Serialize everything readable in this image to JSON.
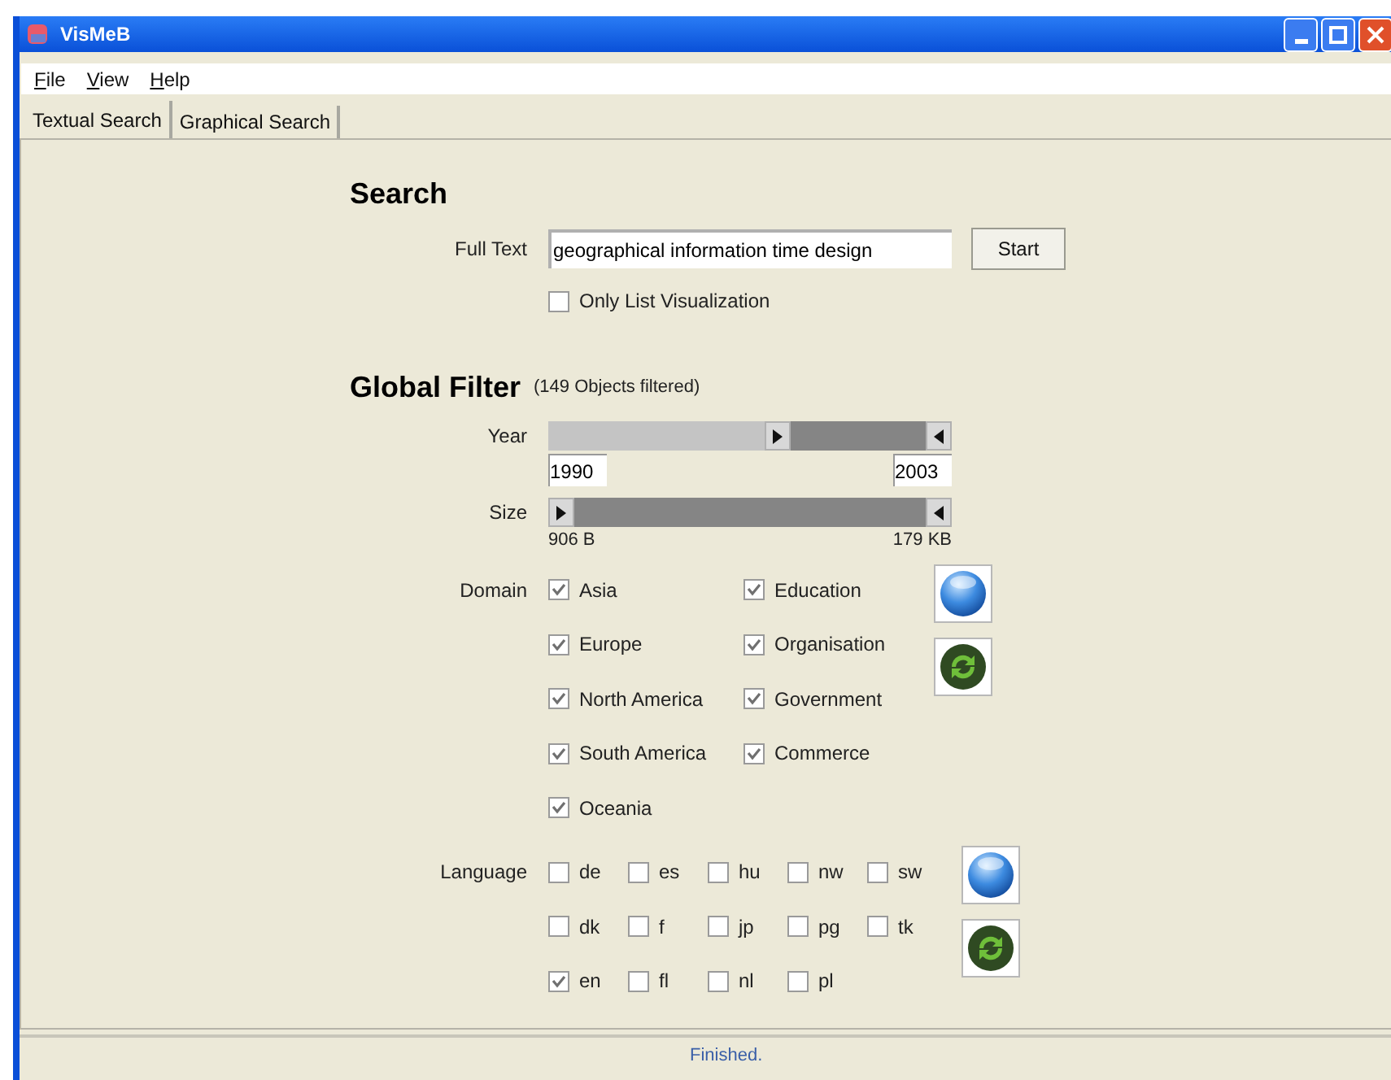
{
  "window": {
    "title": "VisMeB"
  },
  "menu": [
    "File",
    "View",
    "Help"
  ],
  "tabs": [
    {
      "label": "Textual Search",
      "selected": true
    },
    {
      "label": "Graphical Search",
      "selected": false
    }
  ],
  "search": {
    "heading": "Search",
    "full_text": {
      "label": "Full Text",
      "value": "geographical information time design"
    },
    "start_button": "Start",
    "only_list": {
      "label": "Only List Visualization",
      "checked": false
    }
  },
  "global_filter": {
    "heading": "Global Filter",
    "note": "(149 Objects filtered)",
    "year": {
      "label": "Year",
      "level": 0.57,
      "from": "1990",
      "to": "2003"
    },
    "size": {
      "label": "Size",
      "level": 0,
      "from": "906 B",
      "to": "179 KB"
    },
    "domain": {
      "label": "Domain",
      "options": [
        {
          "label": "Asia",
          "checked": true
        },
        {
          "label": "Education",
          "checked": true
        },
        {
          "label": "Europe",
          "checked": true
        },
        {
          "label": "Organisation",
          "checked": true
        },
        {
          "label": "North America",
          "checked": true
        },
        {
          "label": "Government",
          "checked": true
        },
        {
          "label": "South America",
          "checked": true
        },
        {
          "label": "Commerce",
          "checked": true
        },
        {
          "label": "Oceania",
          "checked": true
        }
      ]
    },
    "language": {
      "label": "Language",
      "options": [
        {
          "label": "de",
          "checked": false
        },
        {
          "label": "es",
          "checked": false
        },
        {
          "label": "hu",
          "checked": false
        },
        {
          "label": "nw",
          "checked": false
        },
        {
          "label": "sw",
          "checked": false
        },
        {
          "label": "dk",
          "checked": false
        },
        {
          "label": "f",
          "checked": false
        },
        {
          "label": "jp",
          "checked": false
        },
        {
          "label": "pg",
          "checked": false
        },
        {
          "label": "tk",
          "checked": false
        },
        {
          "label": "en",
          "checked": true
        },
        {
          "label": "fl",
          "checked": false
        },
        {
          "label": "nl",
          "checked": false
        },
        {
          "label": "pl",
          "checked": false
        }
      ]
    }
  },
  "status_bar": "Finished."
}
